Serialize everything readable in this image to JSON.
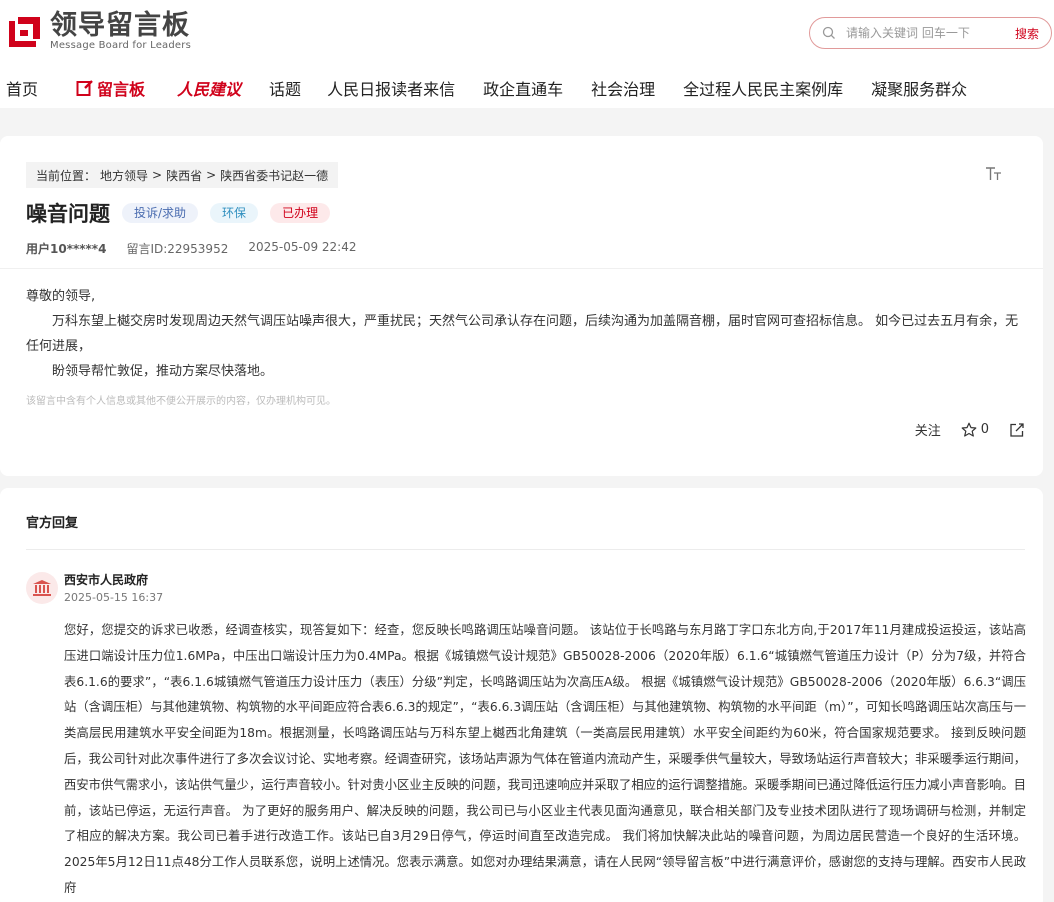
{
  "header": {
    "logo_main": "领导留言板",
    "logo_sub": "Message Board for Leaders",
    "search_placeholder": "请输入关键词 回车一下",
    "search_button": "搜索"
  },
  "nav": [
    {
      "label": "首页"
    },
    {
      "label": "留言板"
    },
    {
      "label": "人民建议"
    },
    {
      "label": "话题"
    },
    {
      "label": "人民日报读者来信"
    },
    {
      "label": "政企直通车"
    },
    {
      "label": "社会治理"
    },
    {
      "label": "全过程人民民主案例库"
    },
    {
      "label": "凝聚服务群众"
    }
  ],
  "breadcrumb": {
    "prefix": "当前位置：",
    "items": [
      "地方领导",
      "陕西省",
      "陕西省委书记赵一德"
    ],
    "sep": ">"
  },
  "message": {
    "title": "噪音问题",
    "tags": [
      "投诉/求助",
      "环保",
      "已办理"
    ],
    "user": "用户10*****4",
    "id_label": "留言ID:22953952",
    "time": "2025-05-09 22:42",
    "greeting": "尊敬的领导,",
    "body": "万科东望上樾交房时发现周边天然气调压站噪声很大，严重扰民；天然气公司承认存在问题，后续沟通为加盖隔音棚，届时官网可查招标信息。 如今已过去五月有余，无任何进展，",
    "closing": "盼领导帮忙敦促，推动方案尽快落地。",
    "notice": "该留言中含有个人信息或其他不便公开展示的内容，仅办理机构可见。",
    "follow": "关注",
    "likes": "0"
  },
  "reply": {
    "heading": "官方回复",
    "org": "西安市人民政府",
    "time": "2025-05-15 16:37",
    "text": "您好，您提交的诉求已收悉，经调查核实，现答复如下：经查，您反映长鸣路调压站噪音问题。 该站位于长鸣路与东月路丁字口东北方向,于2017年11月建成投运投运，该站高压进口端设计压力位1.6MPa，中压出口端设计压力为0.4MPa。根据《城镇燃气设计规范》GB50028-2006（2020年版）6.1.6“城镇燃气管道压力设计（P）分为7级，并符合表6.1.6的要求”，“表6.1.6城镇燃气管道压力设计压力（表压）分级”判定，长鸣路调压站为次高压A级。 根据《城镇燃气设计规范》GB50028-2006（2020年版）6.6.3“调压站（含调压柜）与其他建筑物、构筑物的水平间距应符合表6.6.3的规定”，“表6.6.3调压站（含调压柜）与其他建筑物、构筑物的水平间距（m）”，可知长鸣路调压站次高压与一类高层民用建筑水平安全间距为18m。根据测量，长鸣路调压站与万科东望上樾西北角建筑（一类高层民用建筑）水平安全间距约为60米，符合国家规范要求。 接到反映问题后，我公司针对此次事件进行了多次会议讨论、实地考察。经调查研究，该场站声源为气体在管道内流动产生，采暖季供气量较大，导致场站运行声音较大；非采暖季运行期间，西安市供气需求小，该站供气量少，运行声音较小。针对贵小区业主反映的问题，我司迅速响应并采取了相应的运行调整措施。采暖季期间已通过降低运行压力减小声音影响。目前，该站已停运，无运行声音。 为了更好的服务用户、解决反映的问题，我公司已与小区业主代表见面沟通意见，联合相关部门及专业技术团队进行了现场调研与检测，并制定了相应的解决方案。我公司已着手进行改造工作。该站已自3月29日停气，停运时间直至改造完成。 我们将加快解决此站的噪音问题，为周边居民营造一个良好的生活环境。 2025年5月12日11点48分工作人员联系您，说明上述情况。您表示满意。如您对办理结果满意，请在人民网“领导留言板”中进行满意评价，感谢您的支持与理解。西安市人民政府"
  },
  "colors": {
    "brand_red": "#d0021b",
    "page_bg": "#f4f4f4"
  },
  "icons": [
    "search-icon",
    "edit-icon",
    "font-size-icon",
    "star-icon",
    "share-icon",
    "government-building-icon"
  ]
}
